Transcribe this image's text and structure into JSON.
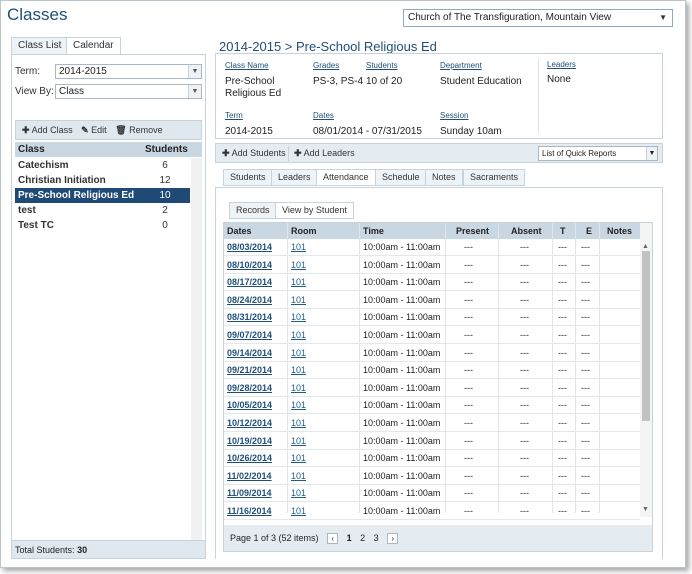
{
  "page_title": "Classes",
  "church_select": "Church of The Transfiguration, Mountain View",
  "left": {
    "tabs": [
      "Class List",
      "Calendar"
    ],
    "term_label": "Term:",
    "term_value": "2014-2015",
    "viewby_label": "View By:",
    "viewby_value": "Class",
    "toolbar": {
      "add": "Add Class",
      "edit": "Edit",
      "remove": "Remove"
    },
    "headers": [
      "Class",
      "Students"
    ],
    "rows": [
      {
        "name": "Catechism",
        "students": "6"
      },
      {
        "name": "Christian Initiation",
        "students": "12"
      },
      {
        "name": "Pre-School Religious Ed",
        "students": "10",
        "selected": true
      },
      {
        "name": "test",
        "students": "2"
      },
      {
        "name": "Test TC",
        "students": "0"
      }
    ],
    "total_label": "Total Students:",
    "total_value": "30"
  },
  "detail": {
    "title": "2014-2015 > Pre-School Religious Ed",
    "labels": {
      "class_name": "Class Name",
      "grades": "Grades",
      "students": "Students",
      "department": "Department",
      "leaders": "Leaders",
      "term": "Term",
      "dates": "Dates",
      "session": "Session"
    },
    "values": {
      "class_name_1": "Pre-School",
      "class_name_2": "Religious Ed",
      "grades": "PS-3, PS-4",
      "students": "10 of 20",
      "department": "Student Education",
      "leaders": "None",
      "term": "2014-2015",
      "dates": "08/01/2014 - 07/31/2015",
      "session": "Sunday 10am"
    },
    "buttons": {
      "add_students": "Add Students",
      "add_leaders": "Add Leaders"
    },
    "quick_reports": "List of Quick Reports",
    "tabs": [
      "Students",
      "Leaders",
      "Attendance",
      "Schedule",
      "Notes",
      "Sacraments"
    ],
    "subtabs": [
      "Records",
      "View by Student"
    ],
    "grid_headers": [
      "Dates",
      "Room",
      "Time",
      "Present",
      "Absent",
      "T",
      "E",
      "Notes"
    ],
    "grid_rows": [
      {
        "date": "08/03/2014",
        "room": "101",
        "time": "10:00am - 11:00am",
        "present": "---",
        "absent": "---",
        "t": "---",
        "e": "---"
      },
      {
        "date": "08/10/2014",
        "room": "101",
        "time": "10:00am - 11:00am",
        "present": "---",
        "absent": "---",
        "t": "---",
        "e": "---"
      },
      {
        "date": "08/17/2014",
        "room": "101",
        "time": "10:00am - 11:00am",
        "present": "---",
        "absent": "---",
        "t": "---",
        "e": "---"
      },
      {
        "date": "08/24/2014",
        "room": "101",
        "time": "10:00am - 11:00am",
        "present": "---",
        "absent": "---",
        "t": "---",
        "e": "---"
      },
      {
        "date": "08/31/2014",
        "room": "101",
        "time": "10:00am - 11:00am",
        "present": "---",
        "absent": "---",
        "t": "---",
        "e": "---"
      },
      {
        "date": "09/07/2014",
        "room": "101",
        "time": "10:00am - 11:00am",
        "present": "---",
        "absent": "---",
        "t": "---",
        "e": "---"
      },
      {
        "date": "09/14/2014",
        "room": "101",
        "time": "10:00am - 11:00am",
        "present": "---",
        "absent": "---",
        "t": "---",
        "e": "---"
      },
      {
        "date": "09/21/2014",
        "room": "101",
        "time": "10:00am - 11:00am",
        "present": "---",
        "absent": "---",
        "t": "---",
        "e": "---"
      },
      {
        "date": "09/28/2014",
        "room": "101",
        "time": "10:00am - 11:00am",
        "present": "---",
        "absent": "---",
        "t": "---",
        "e": "---"
      },
      {
        "date": "10/05/2014",
        "room": "101",
        "time": "10:00am - 11:00am",
        "present": "---",
        "absent": "---",
        "t": "---",
        "e": "---"
      },
      {
        "date": "10/12/2014",
        "room": "101",
        "time": "10:00am - 11:00am",
        "present": "---",
        "absent": "---",
        "t": "---",
        "e": "---"
      },
      {
        "date": "10/19/2014",
        "room": "101",
        "time": "10:00am - 11:00am",
        "present": "---",
        "absent": "---",
        "t": "---",
        "e": "---"
      },
      {
        "date": "10/26/2014",
        "room": "101",
        "time": "10:00am - 11:00am",
        "present": "---",
        "absent": "---",
        "t": "---",
        "e": "---"
      },
      {
        "date": "11/02/2014",
        "room": "101",
        "time": "10:00am - 11:00am",
        "present": "---",
        "absent": "---",
        "t": "---",
        "e": "---"
      },
      {
        "date": "11/09/2014",
        "room": "101",
        "time": "10:00am - 11:00am",
        "present": "---",
        "absent": "---",
        "t": "---",
        "e": "---"
      },
      {
        "date": "11/16/2014",
        "room": "101",
        "time": "10:00am - 11:00am",
        "present": "---",
        "absent": "---",
        "t": "---",
        "e": "---"
      }
    ],
    "pager": {
      "summary": "Page 1 of 3 (52 items)",
      "pages": [
        "1",
        "2",
        "3"
      ]
    }
  }
}
